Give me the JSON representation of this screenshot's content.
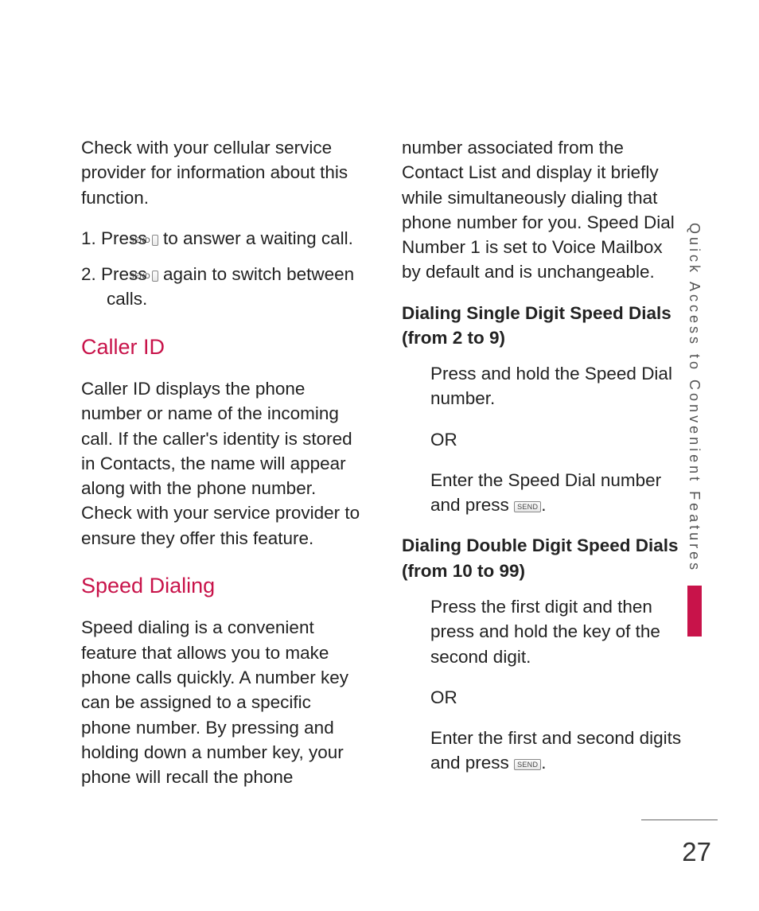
{
  "sendKey": "SEND",
  "left": {
    "intro": "Check with your cellular service provider for information about this function.",
    "s1a": "1. Press ",
    "s1b": " to answer a waiting call.",
    "s2a": "2. Press ",
    "s2b": " again to switch between calls.",
    "callerIdTitle": "Caller ID",
    "callerIdBody": "Caller ID displays the phone number or name of the incoming call. If the caller's identity is stored in Contacts, the name will appear along with the phone number. Check with your service provider to ensure they offer this feature.",
    "speedTitle": "Speed Dialing",
    "speedBody": "Speed dialing is a convenient feature that allows you to make phone calls quickly. A number key can be assigned to a specific phone number. By pressing and holding down a number key, your phone will recall the phone"
  },
  "right": {
    "cont": "number associated from the Contact List and display it briefly while simultaneously dialing that phone number for you. Speed Dial Number 1 is set to Voice Mailbox by default and is unchangeable.",
    "h1": "Dialing Single Digit Speed Dials (from 2 to 9)",
    "s1": "Press and hold the Speed Dial number.",
    "or": "OR",
    "s2a": "Enter the Speed Dial number and press ",
    "s2b": ".",
    "h2": "Dialing Double Digit Speed Dials (from 10 to 99)",
    "d1": "Press the first digit and then press and hold the key of the second digit.",
    "d2a": "Enter the first and second digits and press ",
    "d2b": "."
  },
  "sideLabel": "Quick Access to Convenient Features",
  "pageNumber": "27"
}
